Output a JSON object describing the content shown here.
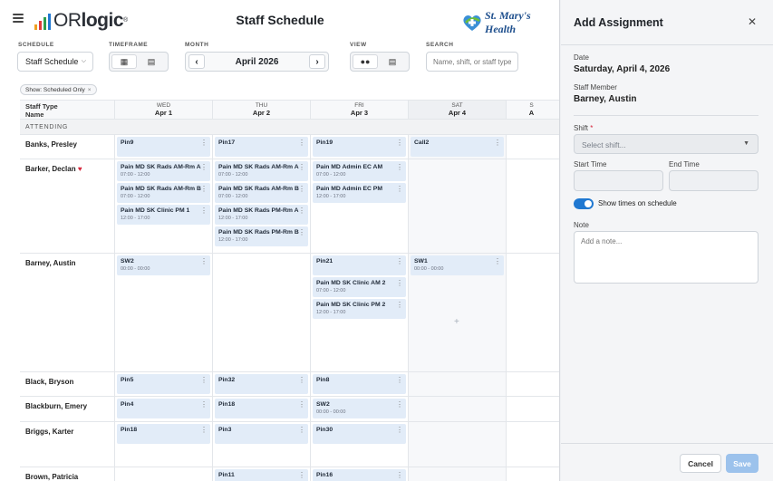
{
  "header": {
    "logo_prefix": "OR",
    "logo_bold": "logic",
    "logo_reg": "®",
    "title": "Staff Schedule",
    "brand_name": "St. Mary's Health"
  },
  "controls": {
    "schedule_label": "SCHEDULE",
    "schedule_value": "Staff Schedule",
    "timeframe_label": "TIMEFRAME",
    "month_label": "MONTH",
    "month_value": "April 2026",
    "view_label": "VIEW",
    "search_label": "SEARCH",
    "search_placeholder": "Name, shift, or staff type",
    "filter_chip": "Show: Scheduled Only"
  },
  "grid": {
    "name_header_1": "Staff Type",
    "name_header_2": "Name",
    "days": [
      {
        "dow": "WED",
        "date": "Apr 1"
      },
      {
        "dow": "THU",
        "date": "Apr 2"
      },
      {
        "dow": "FRI",
        "date": "Apr 3"
      },
      {
        "dow": "SAT",
        "date": "Apr 4"
      },
      {
        "dow": "S",
        "date": "A"
      }
    ],
    "section": "ATTENDING",
    "rows": [
      {
        "name": "Banks, Presley",
        "cells": [
          [
            {
              "title": "Pin9"
            }
          ],
          [
            {
              "title": "Pin17"
            }
          ],
          [
            {
              "title": "Pin19"
            }
          ],
          [
            {
              "title": "Call2"
            }
          ]
        ]
      },
      {
        "name": "Barker, Declan",
        "cells": [
          [
            {
              "title": "Pain MD SK Rads AM-Rm A",
              "time": "07:00 - 12:00"
            },
            {
              "title": "Pain MD SK Rads AM-Rm B",
              "time": "07:00 - 12:00"
            },
            {
              "title": "Pain MD SK Clinic PM 1",
              "time": "12:00 - 17:00"
            }
          ],
          [
            {
              "title": "Pain MD SK Rads AM-Rm A",
              "time": "07:00 - 12:00"
            },
            {
              "title": "Pain MD SK Rads AM-Rm B",
              "time": "07:00 - 12:00"
            },
            {
              "title": "Pain MD SK Rads PM-Rm A",
              "time": "12:00 - 17:00"
            },
            {
              "title": "Pain MD SK Rads PM-Rm B",
              "time": "12:00 - 17:00"
            }
          ],
          [
            {
              "title": "Pain MD Admin EC AM",
              "time": "07:00 - 12:00"
            },
            {
              "title": "Pain MD Admin EC PM",
              "time": "12:00 - 17:00"
            }
          ],
          []
        ]
      },
      {
        "name": "Barney, Austin",
        "cells": [
          [
            {
              "title": "SW2",
              "time": "00:00 - 00:00"
            }
          ],
          [],
          [
            {
              "title": "Pin21"
            },
            {
              "title": "Pain MD SK Clinic AM 2",
              "time": "07:00 - 12:00"
            },
            {
              "title": "Pain MD SK Clinic PM 2",
              "time": "12:00 - 17:00"
            }
          ],
          [
            {
              "title": "SW1",
              "time": "00:00 - 00:00"
            }
          ]
        ]
      },
      {
        "name": "Black, Bryson",
        "cells": [
          [
            {
              "title": "Pin5"
            }
          ],
          [
            {
              "title": "Pin32"
            }
          ],
          [
            {
              "title": "Pin8"
            }
          ],
          []
        ]
      },
      {
        "name": "Blackburn, Emery",
        "cells": [
          [
            {
              "title": "Pin4"
            }
          ],
          [
            {
              "title": "Pin18"
            }
          ],
          [
            {
              "title": "SW2",
              "time": "00:00 - 00:00"
            }
          ],
          []
        ]
      },
      {
        "name": "Briggs, Karter",
        "cells": [
          [
            {
              "title": "Pin18"
            }
          ],
          [
            {
              "title": "Pin3"
            }
          ],
          [
            {
              "title": "Pin30"
            }
          ],
          []
        ]
      },
      {
        "name": "Brown, Patricia",
        "cells": [
          [],
          [
            {
              "title": "Pin11"
            }
          ],
          [
            {
              "title": "Pin16"
            }
          ],
          []
        ]
      }
    ]
  },
  "panel": {
    "title": "Add Assignment",
    "date_label": "Date",
    "date_value": "Saturday, April 4, 2026",
    "member_label": "Staff Member",
    "member_value": "Barney, Austin",
    "shift_label": "Shift",
    "shift_required": "*",
    "shift_placeholder": "Select shift...",
    "start_label": "Start Time",
    "end_label": "End Time",
    "toggle_label": "Show times on schedule",
    "note_label": "Note",
    "note_placeholder": "Add a note...",
    "cancel": "Cancel",
    "save": "Save"
  },
  "colors": {
    "accent": "#1f78d1",
    "card_bg": "#e2ecf8",
    "heart": "#d6243a",
    "save_disabled": "#9cc2ec"
  }
}
